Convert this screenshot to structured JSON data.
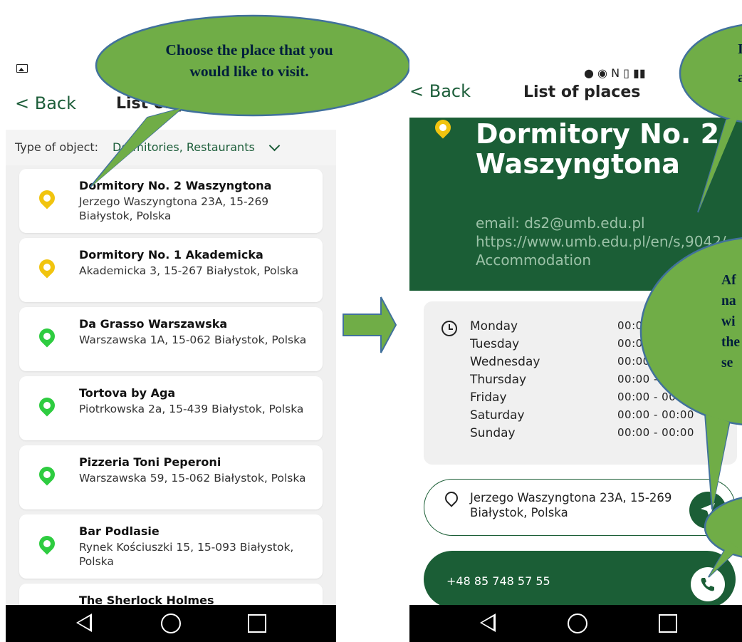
{
  "left_screen": {
    "back_label": "< Back",
    "title": "List of places",
    "filter_label": "Type of object:",
    "filter_value": "Dormitories, Restaurants",
    "places": [
      {
        "name": "Dormitory No. 2 Waszyngtona",
        "address": "Jerzego Waszyngtona 23A, 15-269 Białystok, Polska",
        "kind": "dormitory"
      },
      {
        "name": "Dormitory No. 1 Akademicka",
        "address": "Akademicka 3, 15-267 Białystok, Polska",
        "kind": "dormitory"
      },
      {
        "name": "Da Grasso Warszawska",
        "address": "Warszawska 1A, 15-062 Białystok, Polska",
        "kind": "restaurant"
      },
      {
        "name": "Tortova by Aga",
        "address": "Piotrkowska 2a, 15-439 Białystok, Polska",
        "kind": "restaurant"
      },
      {
        "name": "Pizzeria Toni Peperoni",
        "address": "Warszawska 59, 15-062 Białystok, Polska",
        "kind": "restaurant"
      },
      {
        "name": "Bar Podlasie",
        "address": "Rynek Kościuszki 15, 15-093 Białystok, Polska",
        "kind": "restaurant"
      },
      {
        "name": "The Sherlock Holmes",
        "address": "",
        "kind": "restaurant"
      }
    ]
  },
  "right_screen": {
    "back_label": "< Back",
    "title": "List of places",
    "place_title": "Dormitory No. 2 Waszyngtona",
    "contact_email": "email: ds2@umb.edu.pl",
    "contact_url": "https://www.umb.edu.pl/en/s,9042/Accommodation",
    "hours": [
      {
        "day": "Monday",
        "time": "00:00 - 00:00"
      },
      {
        "day": "Tuesday",
        "time": "00:00 - 00:00"
      },
      {
        "day": "Wednesday",
        "time": "00:00 - 00:00"
      },
      {
        "day": "Thursday",
        "time": "00:00 - 00:00"
      },
      {
        "day": "Friday",
        "time": "00:00 - 00:00"
      },
      {
        "day": "Saturday",
        "time": "00:00 - 00:00"
      },
      {
        "day": "Sunday",
        "time": "00:00 - 00:00"
      }
    ],
    "address": "Jerzego Waszyngtona 23A, 15-269 Białystok, Polska",
    "phone": "+48 85 748 57 55"
  },
  "callouts": {
    "bubble1": "Choose the place that you would like to visit.",
    "bubble2": "I",
    "bubble2b": "a",
    "bubble3_lines": [
      "Af",
      "na",
      "wi",
      "the",
      "se"
    ]
  },
  "colors": {
    "brand_green": "#1b5e36",
    "dormitory_pin": "#f1c40f",
    "restaurant_pin": "#2ecc40",
    "callout_fill": "#70ad47"
  }
}
